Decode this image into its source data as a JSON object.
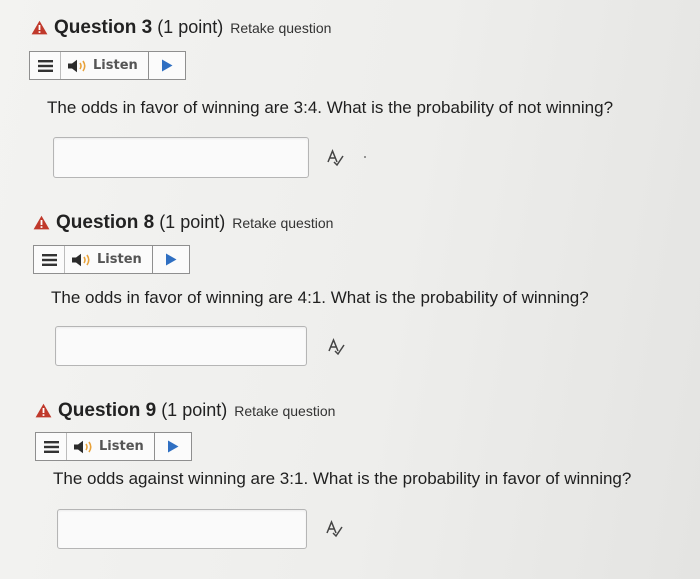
{
  "colors": {
    "warning": "#c0392b",
    "play": "#2f6fc2",
    "text": "#1f1f1f"
  },
  "questions": [
    {
      "title": "Question 3",
      "points": "(1 point)",
      "retake": "Retake question",
      "listen": {
        "label": "Listen",
        "menu_icon": "menu-icon",
        "speaker_icon": "speaker-icon",
        "play_icon": "play-icon"
      },
      "prompt": "The odds in favor of winning are 3:4. What is the probability of not winning?",
      "answer": {
        "value": "",
        "placeholder": ""
      }
    },
    {
      "title": "Question 8",
      "points": "(1 point)",
      "retake": "Retake question",
      "listen": {
        "label": "Listen",
        "menu_icon": "menu-icon",
        "speaker_icon": "speaker-icon",
        "play_icon": "play-icon"
      },
      "prompt": "The odds in favor of winning are 4:1. What is the probability of winning?",
      "answer": {
        "value": "",
        "placeholder": ""
      }
    },
    {
      "title": "Question 9",
      "points": "(1 point)",
      "retake": "Retake question",
      "listen": {
        "label": "Listen",
        "menu_icon": "menu-icon",
        "speaker_icon": "speaker-icon",
        "play_icon": "play-icon"
      },
      "prompt": "The odds against winning are 3:1. What is the probability in favor of winning?",
      "answer": {
        "value": "",
        "placeholder": ""
      }
    }
  ]
}
